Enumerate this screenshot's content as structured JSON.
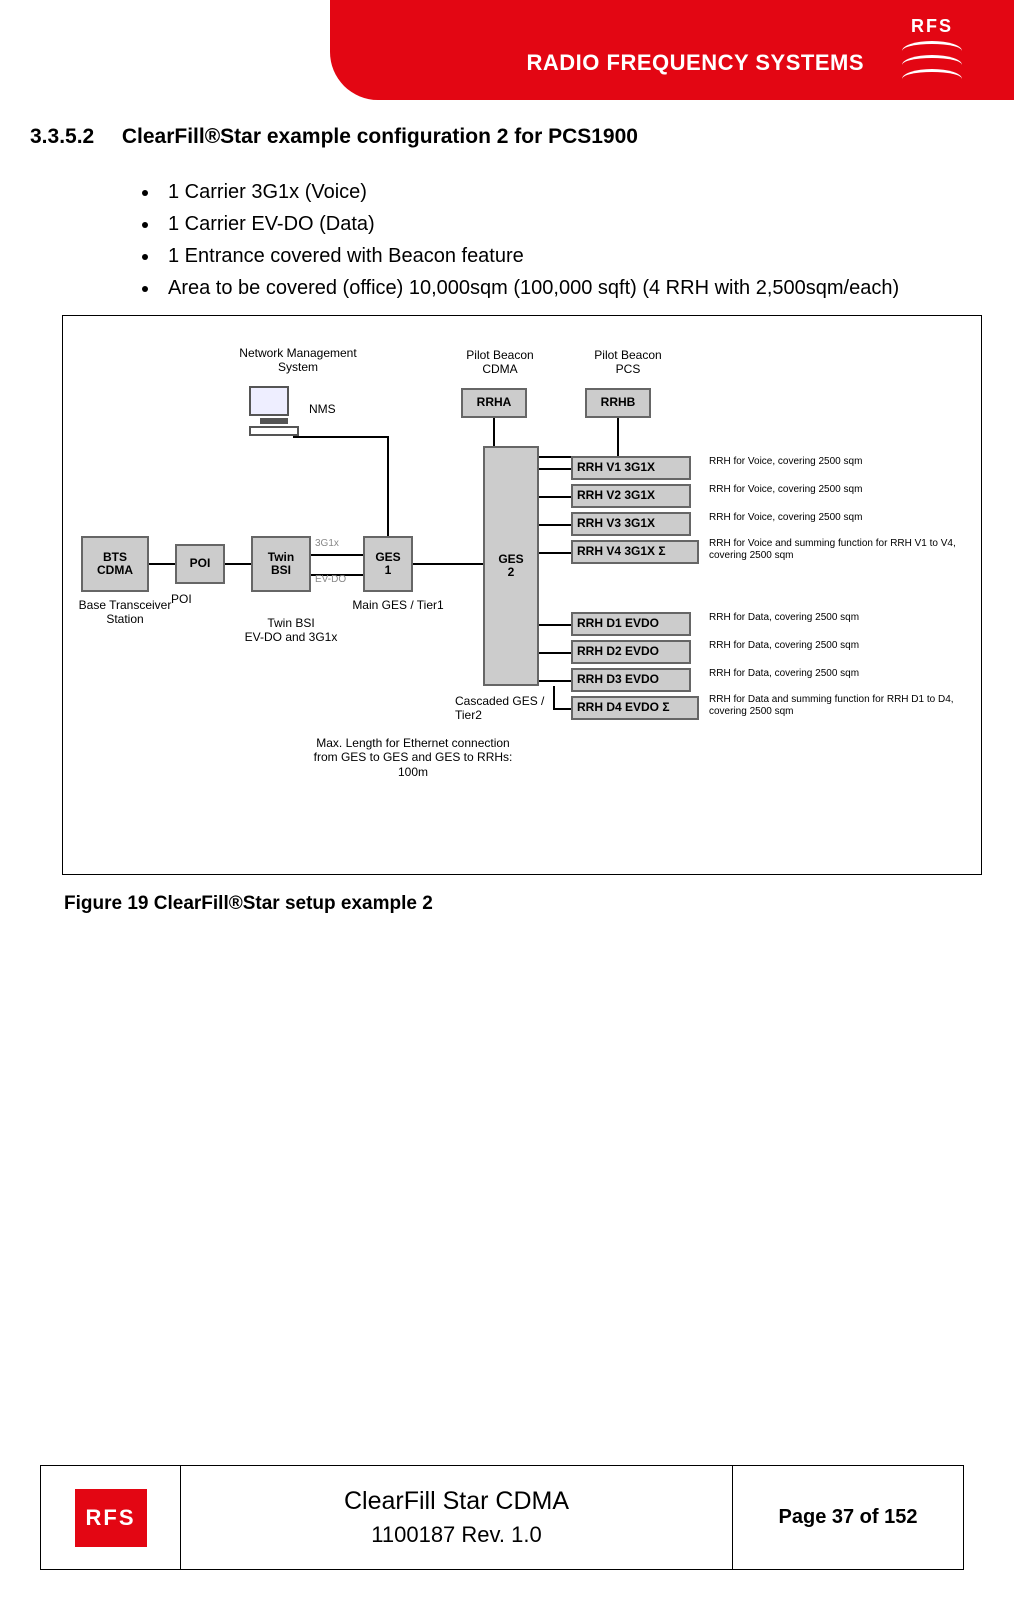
{
  "brand": {
    "tagline": "RADIO FREQUENCY SYSTEMS",
    "short": "RFS"
  },
  "heading": {
    "number": "3.3.5.2",
    "title": "ClearFill®Star example configuration 2 for PCS1900"
  },
  "bullets": [
    "1 Carrier 3G1x (Voice)",
    "1 Carrier EV-DO (Data)",
    "1 Entrance covered with Beacon feature",
    "Area to be covered (office) 10,000sqm (100,000 sqft) (4 RRH with 2,500sqm/each)"
  ],
  "diagram": {
    "nms_title": "Network Management\nSystem",
    "nms_label": "NMS",
    "pilot_cdma": "Pilot Beacon\nCDMA",
    "pilot_pcs": "Pilot Beacon\nPCS",
    "rrha": "RRHA",
    "rrhb": "RRHB",
    "bts": "BTS\nCDMA",
    "bts_label": "Base Transceiver\nStation",
    "poi": "POI",
    "poi_label": "POI",
    "twin": "Twin\nBSI",
    "twin_label": "Twin BSI\nEV-DO and 3G1x",
    "ges1": "GES\n1",
    "ges1_label": "Main GES / Tier1",
    "ges2": "GES\n2",
    "ges2_label": "Cascaded GES /\nTier2",
    "eth_note": "Max. Length for Ethernet connection\nfrom GES to GES and GES to RRHs:\n100m",
    "link_3g1x": "3G1x",
    "link_evdo": "EV-DO",
    "voice_rrh": [
      {
        "box": "RRH V1 3G1X",
        "note": "RRH for Voice, covering 2500 sqm"
      },
      {
        "box": "RRH V2 3G1X",
        "note": "RRH for Voice, covering 2500 sqm"
      },
      {
        "box": "RRH V3 3G1X",
        "note": "RRH for Voice, covering 2500 sqm"
      },
      {
        "box": "RRH V4 3G1X Σ",
        "note": "RRH for Voice and summing function for RRH V1 to V4, covering 2500 sqm"
      }
    ],
    "data_rrh": [
      {
        "box": "RRH D1 EVDO",
        "note": "RRH for Data, covering 2500 sqm"
      },
      {
        "box": "RRH D2 EVDO",
        "note": "RRH for Data, covering 2500 sqm"
      },
      {
        "box": "RRH D3 EVDO",
        "note": "RRH for Data, covering 2500 sqm"
      },
      {
        "box": "RRH D4 EVDO Σ",
        "note": "RRH for Data and summing function for RRH D1 to D4, covering 2500 sqm"
      }
    ]
  },
  "figure_caption": "Figure 19 ClearFill®Star setup example 2",
  "footer": {
    "logo": "RFS",
    "title1": "ClearFill Star CDMA",
    "title2": "1100187 Rev. 1.0",
    "page": "Page 37 of 152"
  }
}
